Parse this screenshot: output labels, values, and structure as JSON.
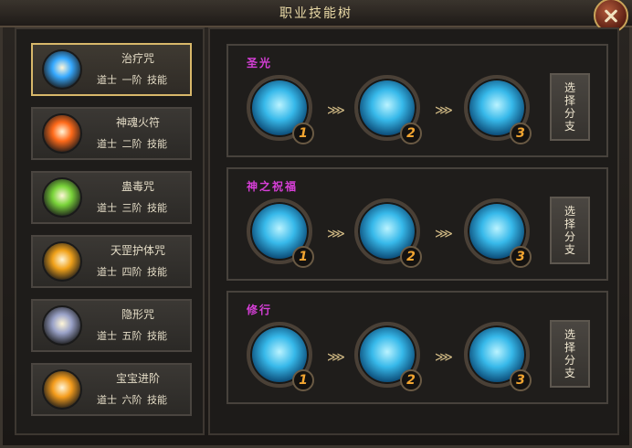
{
  "window": {
    "title": "职业技能树"
  },
  "skills": [
    {
      "name": "治疗咒",
      "class": "道士",
      "rank": "一阶",
      "type": "技能",
      "selected": true,
      "icon": "healing-icon",
      "color": "#36a9ff"
    },
    {
      "name": "神魂火符",
      "class": "道士",
      "rank": "二阶",
      "type": "技能",
      "selected": false,
      "icon": "fire-talisman-icon",
      "color": "#ff6a1a"
    },
    {
      "name": "蛊毒咒",
      "class": "道士",
      "rank": "三阶",
      "type": "技能",
      "selected": false,
      "icon": "poison-icon",
      "color": "#7ad43a"
    },
    {
      "name": "天罡护体咒",
      "class": "道士",
      "rank": "四阶",
      "type": "技能",
      "selected": false,
      "icon": "shield-skull-icon",
      "color": "#f0a11a"
    },
    {
      "name": "隐形咒",
      "class": "道士",
      "rank": "五阶",
      "type": "技能",
      "selected": false,
      "icon": "invisibility-icon",
      "color": "#9aa2c8"
    },
    {
      "name": "宝宝进阶",
      "class": "道士",
      "rank": "六阶",
      "type": "技能",
      "selected": false,
      "icon": "pet-upgrade-icon",
      "color": "#f49c1c"
    }
  ],
  "branches": [
    {
      "title": "圣光",
      "levels": [
        "1",
        "2",
        "3"
      ],
      "button": "选择分支"
    },
    {
      "title": "神之祝福",
      "levels": [
        "1",
        "2",
        "3"
      ],
      "button": "选择分支"
    },
    {
      "title": "修行",
      "levels": [
        "1",
        "2",
        "3"
      ],
      "button": "选择分支"
    }
  ],
  "arrow_glyph": "⋙",
  "colors": {
    "selected_border": "#d8b86a",
    "branch_title": "#d73fd8",
    "level_number": "#f2a531"
  }
}
